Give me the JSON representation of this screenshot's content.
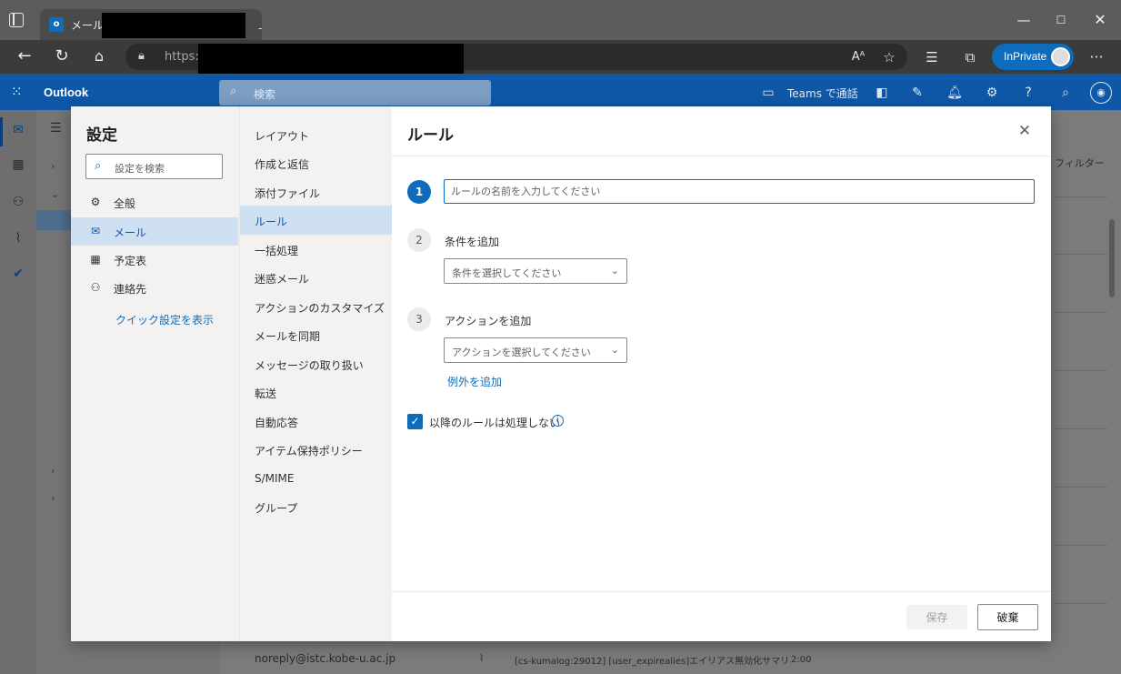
{
  "browser": {
    "tab_title": "メール -",
    "tab_dash": "-",
    "favicon_letter": "o",
    "url": "https:/",
    "inprivate_label": "InPrivate",
    "window_controls": {
      "minimize": "—",
      "maximize": "☐",
      "close": "✕"
    }
  },
  "outlook": {
    "brand": "Outlook",
    "search_placeholder": "検索",
    "teams_label": "Teams で通話"
  },
  "background": {
    "filter_label": "フィルター",
    "bottom_sender": "noreply@istc.kobe-u.ac.jp",
    "bottom_subject": "[cs-kumalog:29012] [user_expirealies]エイリアス無効化サマリ",
    "bottom_time": "2:00"
  },
  "settings": {
    "title": "設定",
    "search_placeholder": "設定を検索",
    "categories": [
      {
        "label": "全般",
        "icon": "gear-icon"
      },
      {
        "label": "メール",
        "icon": "mail-icon"
      },
      {
        "label": "予定表",
        "icon": "calendar-icon"
      },
      {
        "label": "連絡先",
        "icon": "people-icon"
      }
    ],
    "quick_settings_link": "クイック設定を表示",
    "subcategories": [
      "レイアウト",
      "作成と返信",
      "添付ファイル",
      "ルール",
      "一括処理",
      "迷惑メール",
      "アクションのカスタマイズ",
      "メールを同期",
      "メッセージの取り扱い",
      "転送",
      "自動応答",
      "アイテム保持ポリシー",
      "S/MIME",
      "グループ"
    ],
    "selected_subcategory": "ルール"
  },
  "rule_form": {
    "title": "ルール",
    "step1_number": "1",
    "name_placeholder": "ルールの名前を入力してください",
    "name_value": "",
    "step2_number": "2",
    "step2_label": "条件を追加",
    "condition_placeholder": "条件を選択してください",
    "step3_number": "3",
    "step3_label": "アクションを追加",
    "action_placeholder": "アクションを選択してください",
    "add_exception_link": "例外を追加",
    "stop_processing_label": "以降のルールは処理しない",
    "stop_processing_checked": true,
    "save_label": "保存",
    "discard_label": "破棄"
  },
  "colors": {
    "accent": "#0f6cbd",
    "outlook_header": "#0f58a8",
    "selected_bg": "#cfe0f2"
  }
}
